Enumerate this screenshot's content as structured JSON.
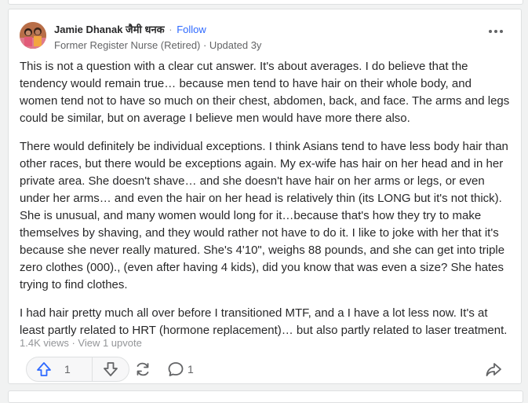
{
  "author": {
    "name": "Jamie Dhanak जैमी धनक",
    "follow_label": "Follow",
    "separator": "·",
    "credential": "Former Register Nurse (Retired) · Updated 3y"
  },
  "answer": {
    "paragraphs": [
      "This is not a question with a clear cut answer. It's about averages. I do believe that the tendency would remain true… because men tend to have hair on their whole body, and women tend not to have so much on their chest, abdomen, back, and face. The arms and legs could be similar, but on average I believe men would have more there also.",
      "There would definitely be individual exceptions. I think Asians tend to have less body hair than other races, but there would be exceptions again. My ex-wife has hair on her head and in her private area. She doesn't shave… and she doesn't have hair on her arms or legs, or even under her arms… and even the hair on her head is relatively thin (its LONG but it's not thick). She is unusual, and many women would long for it…because that's how they try to make themselves by shaving, and they would rather not have to do it. I like to joke with her that it's because she never really matured. She's 4'10\", weighs 88 pounds, and she can get into triple zero clothes (000)., (even after having 4 kids), did you know that was even a size? She hates trying to find clothes.",
      "I had hair pretty much all over before I transitioned MTF, and a I have a lot less now. It's at least partly related to HRT (hormone replacement)… but also partly related to laser treatment."
    ]
  },
  "meta": "1.4K views · View 1 upvote",
  "actions": {
    "upvote_count": "1",
    "comment_count": "1"
  },
  "colors": {
    "accent": "#2e69ff",
    "muted": "#636466"
  },
  "icons": [
    "more-options-icon",
    "upvote-arrow-icon",
    "downvote-arrow-icon",
    "share-reshare-icon",
    "comment-icon",
    "share-icon"
  ]
}
